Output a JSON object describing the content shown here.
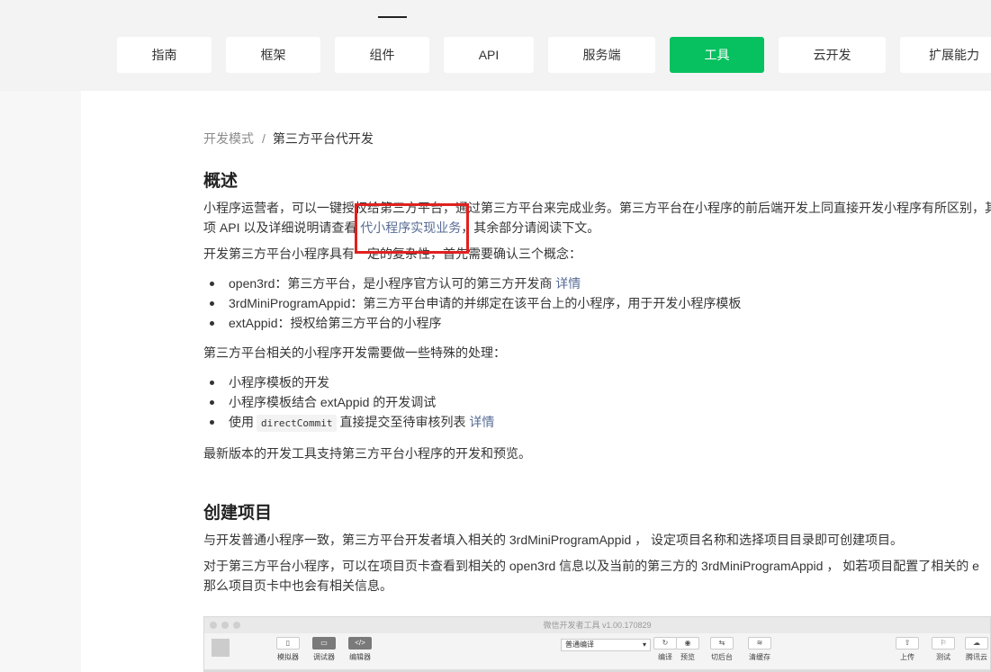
{
  "nav": {
    "tabs": [
      {
        "label": "指南"
      },
      {
        "label": "框架"
      },
      {
        "label": "组件"
      },
      {
        "label": "API"
      },
      {
        "label": "服务端"
      },
      {
        "label": "工具"
      },
      {
        "label": "云开发"
      },
      {
        "label": "扩展能力"
      }
    ],
    "active_tab": "工具",
    "accent_color": "#07c160"
  },
  "breadcrumb": {
    "parent": "开发模式",
    "separator": "/",
    "current": "第三方平台代开发"
  },
  "overview": {
    "heading": "概述",
    "para1_line1": "小程序运营者，可以一键授权给第三方平台，通过第三方平台来完成业务。第三方平台在小程序的前后端开发上同直接开发小程序有所区别，其",
    "para1_line2_pre": "项 API 以及详细说明请查看",
    "para1_link": "代小程序实现业务",
    "para1_line2_post": "，其余部分请阅读下文。",
    "para2": "开发第三方平台小程序具有一定的复杂性，首先需要确认三个概念：",
    "concepts": [
      {
        "text": "open3rd：第三方平台，是小程序官方认可的第三方开发商 ",
        "link": "详情"
      },
      {
        "text": "3rdMiniProgramAppid：第三方平台申请的并绑定在该平台上的小程序，用于开发小程序模板",
        "link": ""
      },
      {
        "text": "extAppid：授权给第三方平台的小程序",
        "link": ""
      }
    ],
    "para3": "第三方平台相关的小程序开发需要做一些特殊的处理：",
    "special_1": "小程序模板的开发",
    "special_2": "小程序模板结合 extAppid 的开发调试",
    "special_3_pre": "使用",
    "special_3_code": "directCommit",
    "special_3_post": "直接提交至待审核列表 ",
    "special_3_link": "详情",
    "para4": "最新版本的开发工具支持第三方平台小程序的开发和预览。"
  },
  "create": {
    "heading": "创建项目",
    "para1": "与开发普通小程序一致，第三方平台开发者填入相关的 3rdMiniProgramAppid ， 设定项目名称和选择项目目录即可创建项目。",
    "para2_line1": "对于第三方平台小程序，可以在项目页卡查看到相关的 open3rd 信息以及当前的第三方的 3rdMiniProgramAppid ， 如若项目配置了相关的 e",
    "para2_line2": "那么项目页卡中也会有相关信息。"
  },
  "screenshot": {
    "window_title": "微信开发者工具 v1.00.170829",
    "left_buttons": [
      {
        "label": "模拟器",
        "icon": "▯"
      },
      {
        "label": "调试器",
        "icon": "▭"
      },
      {
        "label": "编辑器",
        "icon": "</>"
      }
    ],
    "compile_mode": "普通编译",
    "mid_buttons": [
      {
        "label": "编译",
        "icon": "↻"
      },
      {
        "label": "预览",
        "icon": "◉"
      },
      {
        "label": "切后台",
        "icon": "⇆"
      },
      {
        "label": "清缓存",
        "icon": "≋"
      }
    ],
    "right_buttons": [
      {
        "label": "上传",
        "icon": "⇧"
      },
      {
        "label": "测试",
        "icon": "⚐"
      },
      {
        "label": "腾讯云",
        "icon": "☁"
      }
    ]
  }
}
